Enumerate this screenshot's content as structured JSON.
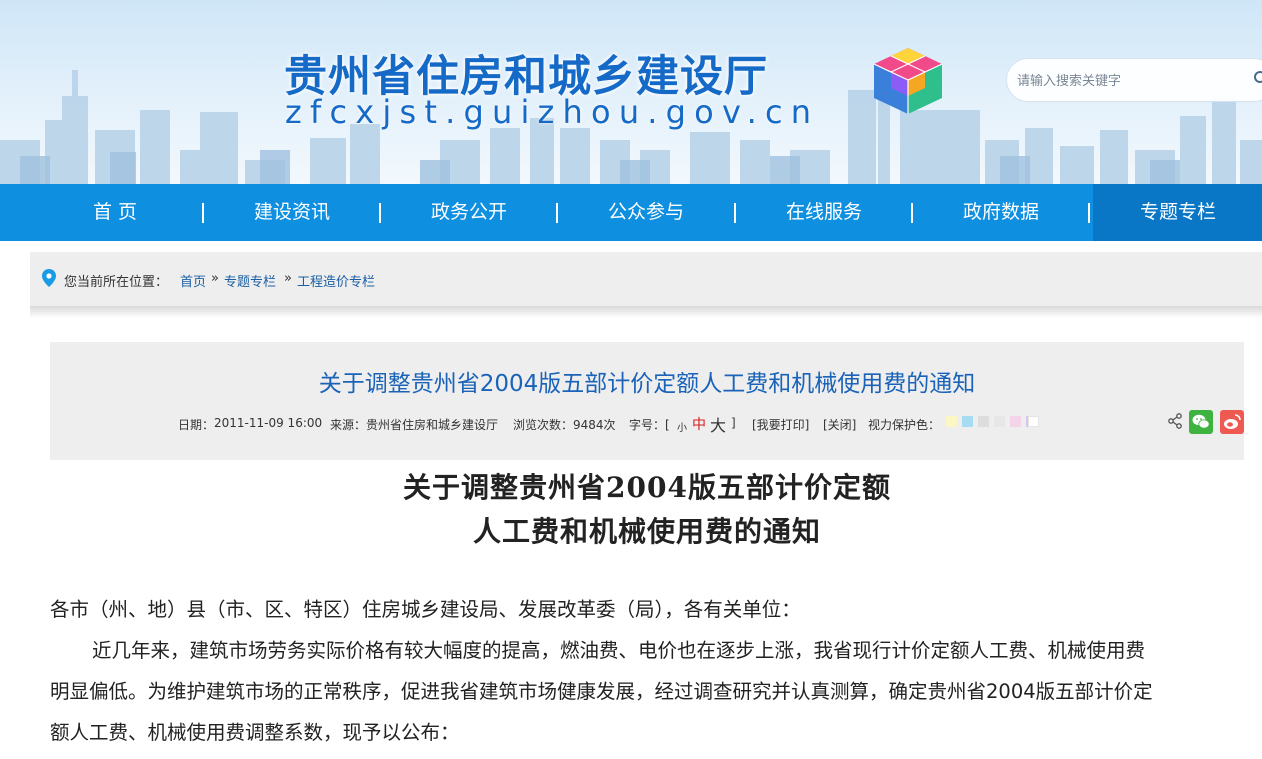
{
  "header": {
    "site_title": "贵州省住房和城乡建设厅",
    "site_domain": "zfcxjst.guizhou.gov.cn",
    "search_placeholder": "请输入搜索关键字"
  },
  "nav": {
    "items": [
      {
        "label": "首  页"
      },
      {
        "label": "建设资讯"
      },
      {
        "label": "政务公开"
      },
      {
        "label": "公众参与"
      },
      {
        "label": "在线服务"
      },
      {
        "label": "政府数据"
      },
      {
        "label": "专题专栏"
      }
    ]
  },
  "breadcrumb": {
    "prefix": "您当前所在位置：",
    "items": [
      {
        "label": "首页"
      },
      {
        "label": "专题专栏"
      },
      {
        "label": "工程造价专栏"
      }
    ],
    "separator": "»"
  },
  "article": {
    "title": "关于调整贵州省2004版五部计价定额人工费和机械使用费的通知",
    "date_label": "日期：",
    "date": "2011-11-09 16:00",
    "source_label": "来源：",
    "source": "贵州省住房和城乡建设厅",
    "views_label": "浏览次数：",
    "views": "9484次",
    "font_label": "字号：[",
    "font_small": "小",
    "font_medium": "中",
    "font_large": "大",
    "font_close": "]",
    "print_label": "[我要打印]",
    "close_label": "[关闭]",
    "eye_label": "视力保护色：",
    "eye_colors": [
      "#faf7c4",
      "#a6dcf2",
      "#dddddd",
      "#e7e7e7",
      "#f5d3e9",
      "#d4c6f0",
      "#ffffff"
    ]
  },
  "document": {
    "title_line1": "关于调整贵州省2004版五部计价定额",
    "title_line2": "人工费和机械使用费的通知",
    "salutation": "各市（州、地）县（市、区、特区）住房城乡建设局、发展改革委（局），各有关单位：",
    "body_line1": "近几年来，建筑市场劳务实际价格有较大幅度的提高，燃油费、电价也在逐步上涨，我省现行计价定额人工费、机械使用费",
    "body_line2": "明显偏低。为维护建筑市场的正常秩序，促进我省建筑市场健康发展，经过调查研究并认真测算，确定贵州省2004版五部计价定",
    "body_line3": "额人工费、机械使用费调整系数，现予以公布："
  }
}
